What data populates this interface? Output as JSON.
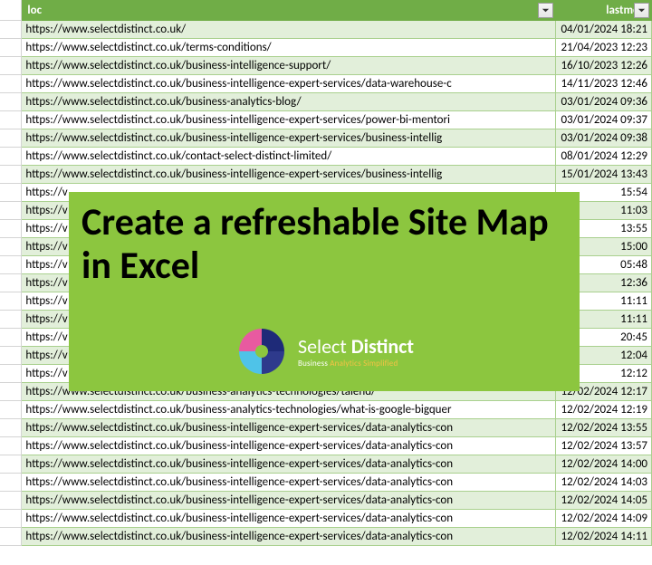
{
  "table": {
    "columns": {
      "loc": "loc",
      "lastmod": "lastmod"
    },
    "rows": [
      {
        "loc": "https://www.selectdistinct.co.uk/",
        "lastmod": "04/01/2024 18:21"
      },
      {
        "loc": "https://www.selectdistinct.co.uk/terms-conditions/",
        "lastmod": "21/04/2023 12:23"
      },
      {
        "loc": "https://www.selectdistinct.co.uk/business-intelligence-support/",
        "lastmod": "16/10/2023 12:26"
      },
      {
        "loc": "https://www.selectdistinct.co.uk/business-intelligence-expert-services/data-warehouse-c",
        "lastmod": "14/11/2023 12:46"
      },
      {
        "loc": "https://www.selectdistinct.co.uk/business-analytics-blog/",
        "lastmod": "03/01/2024 09:36"
      },
      {
        "loc": "https://www.selectdistinct.co.uk/business-intelligence-expert-services/power-bi-mentori",
        "lastmod": "03/01/2024 09:37"
      },
      {
        "loc": "https://www.selectdistinct.co.uk/business-intelligence-expert-services/business-intellig",
        "lastmod": "03/01/2024 09:38"
      },
      {
        "loc": "https://www.selectdistinct.co.uk/contact-select-distinct-limited/",
        "lastmod": "08/01/2024 12:29"
      },
      {
        "loc": "https://www.selectdistinct.co.uk/business-intelligence-expert-services/business-intellig",
        "lastmod": "15/01/2024 13:43"
      },
      {
        "loc": "https://v",
        "lastmod": "15:54"
      },
      {
        "loc": "https://v",
        "lastmod": "11:03"
      },
      {
        "loc": "https://v",
        "lastmod": "13:55"
      },
      {
        "loc": "https://v",
        "lastmod": "15:00"
      },
      {
        "loc": "https://v",
        "lastmod": "05:48"
      },
      {
        "loc": "https://v",
        "lastmod": "12:36"
      },
      {
        "loc": "https://v",
        "lastmod": "11:11"
      },
      {
        "loc": "https://v",
        "lastmod": "11:11"
      },
      {
        "loc": "https://v",
        "lastmod": "20:45"
      },
      {
        "loc": "https://v",
        "lastmod": "12:04"
      },
      {
        "loc": "https://v",
        "lastmod": "12:12"
      },
      {
        "loc": "https://www.selectdistinct.co.uk/business-analytics-technologies/talend/",
        "lastmod": "12/02/2024 12:17"
      },
      {
        "loc": "https://www.selectdistinct.co.uk/business-analytics-technologies/what-is-google-bigquer",
        "lastmod": "12/02/2024 12:19"
      },
      {
        "loc": "https://www.selectdistinct.co.uk/business-intelligence-expert-services/data-analytics-con",
        "lastmod": "12/02/2024 13:55"
      },
      {
        "loc": "https://www.selectdistinct.co.uk/business-intelligence-expert-services/data-analytics-con",
        "lastmod": "12/02/2024 13:57"
      },
      {
        "loc": "https://www.selectdistinct.co.uk/business-intelligence-expert-services/data-analytics-con",
        "lastmod": "12/02/2024 14:00"
      },
      {
        "loc": "https://www.selectdistinct.co.uk/business-intelligence-expert-services/data-analytics-con",
        "lastmod": "12/02/2024 14:03"
      },
      {
        "loc": "https://www.selectdistinct.co.uk/business-intelligence-expert-services/data-analytics-con",
        "lastmod": "12/02/2024 14:05"
      },
      {
        "loc": "https://www.selectdistinct.co.uk/business-intelligence-expert-services/data-analytics-con",
        "lastmod": "12/02/2024 14:09"
      },
      {
        "loc": "https://www.selectdistinct.co.uk/business-intelligence-expert-services/data-analytics-con",
        "lastmod": "12/02/2024 14:11"
      }
    ]
  },
  "overlay": {
    "title": "Create a refreshable Site Map in Excel",
    "brand_main": "Select",
    "brand_bold": "Distinct",
    "tagline_prefix": "Business ",
    "tagline_highlight": "Analytics Simplified"
  }
}
